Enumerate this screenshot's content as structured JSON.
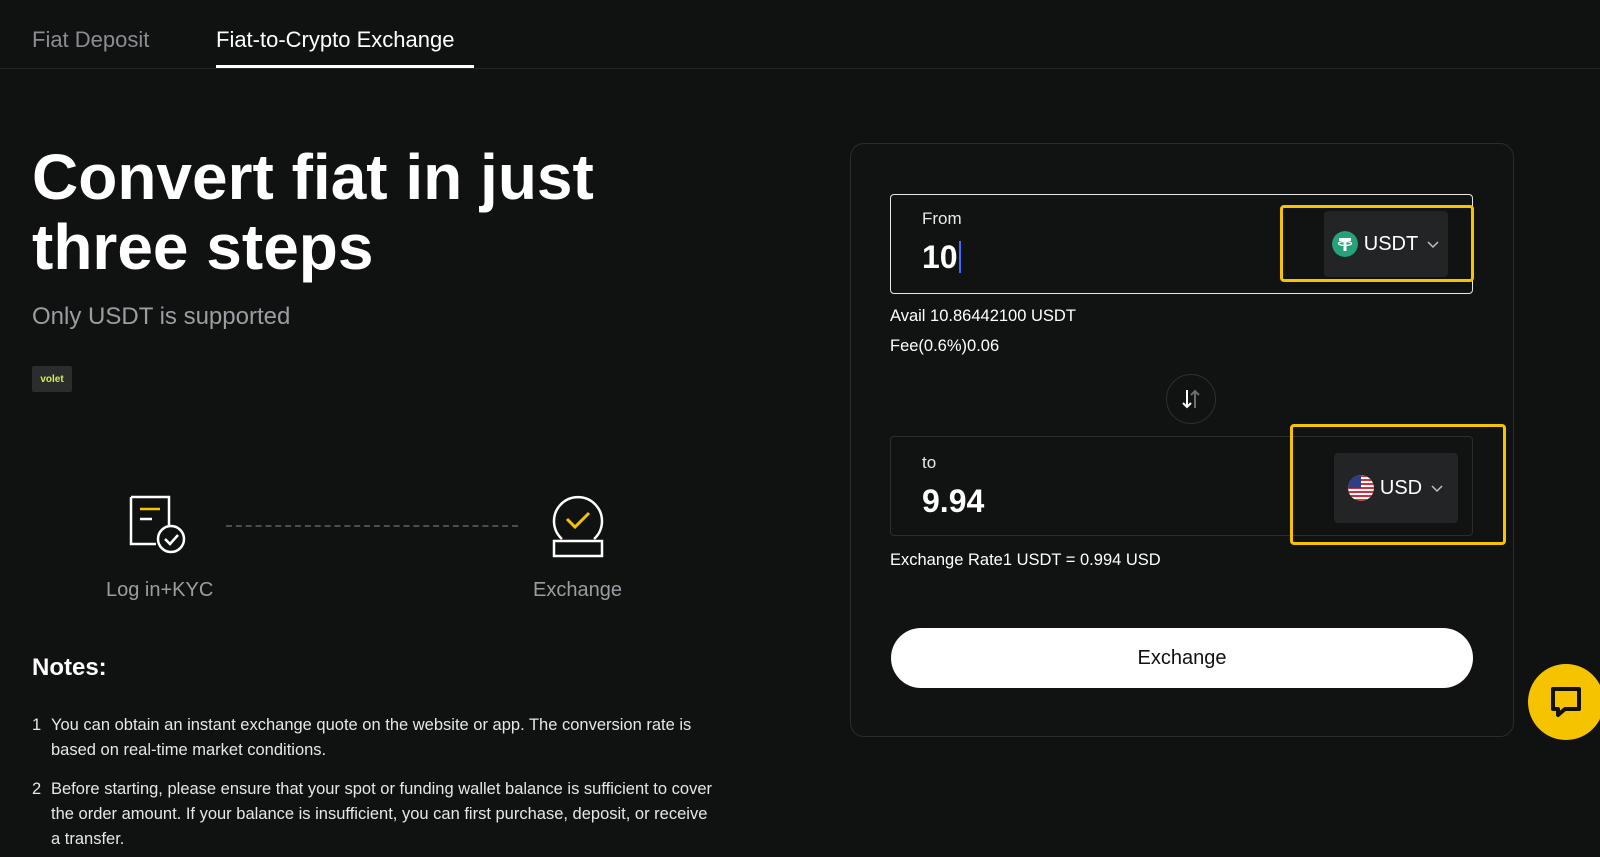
{
  "tabs": [
    {
      "label": "Fiat Deposit",
      "active": false
    },
    {
      "label": "Fiat-to-Crypto Exchange",
      "active": true
    }
  ],
  "hero": {
    "title": "Convert fiat in just three steps",
    "subtitle": "Only USDT is supported",
    "provider_logo": "volet"
  },
  "steps": [
    {
      "label": "Log in+KYC",
      "icon": "document-check-icon"
    },
    {
      "label": "Exchange",
      "icon": "exchange-check-icon"
    }
  ],
  "notes": {
    "title": "Notes:",
    "items": [
      {
        "num": "1",
        "text": "You can obtain an instant exchange quote on the website or app. The conversion rate is based on real-time market conditions."
      },
      {
        "num": "2",
        "text": "Before starting, please ensure that your spot or funding wallet balance is sufficient to cover the order amount. If your balance is insufficient, you can first purchase, deposit, or receive a transfer."
      }
    ]
  },
  "exchange": {
    "from": {
      "label": "From",
      "value": "10",
      "currency": "USDT",
      "currency_icon": "tether-icon"
    },
    "avail": "Avail 10.86442100 USDT",
    "fee": "Fee(0.6%)0.06",
    "to": {
      "label": "to",
      "value": "9.94",
      "currency": "USD",
      "currency_icon": "us-flag-icon"
    },
    "rate": "Exchange Rate1 USDT = 0.994 USD",
    "button_label": "Exchange",
    "highlight_color": "#f5c300"
  },
  "colors": {
    "background": "#101111",
    "accent": "#f5c300",
    "usdt": "#26a17b"
  }
}
